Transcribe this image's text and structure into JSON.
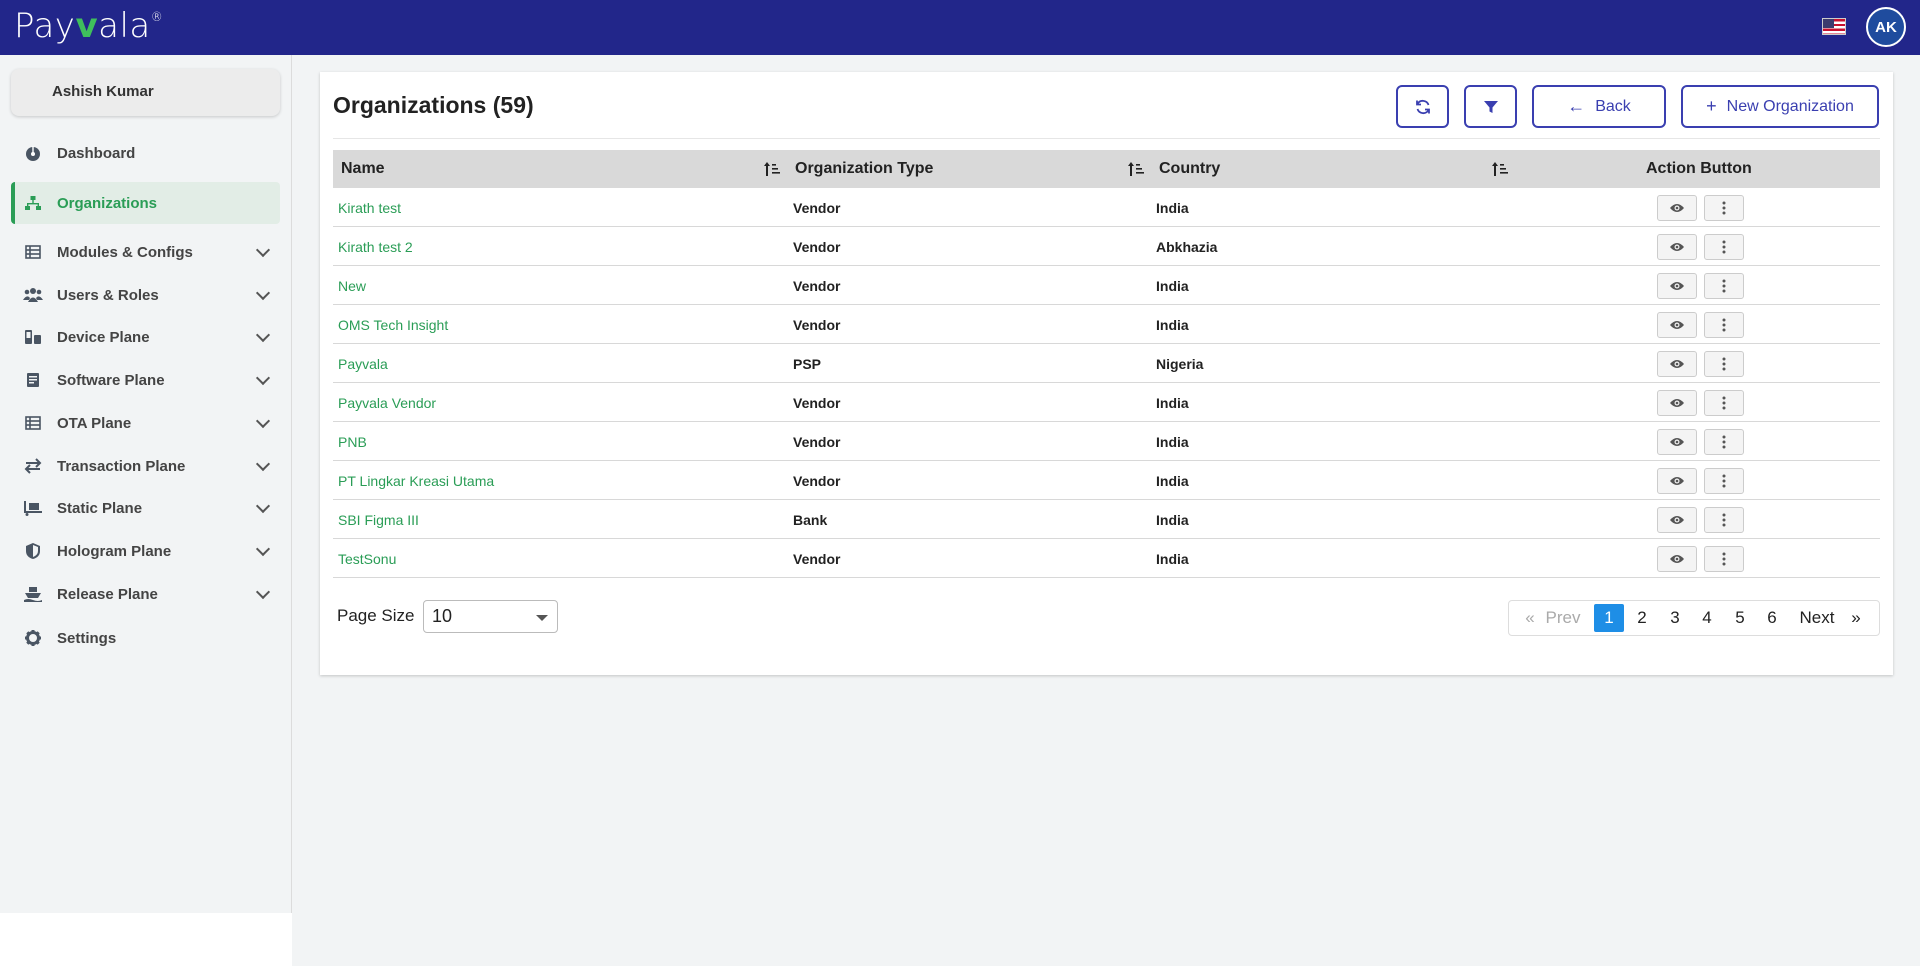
{
  "app": {
    "logo_text_left": "Pay",
    "logo_text_v": "v",
    "logo_text_right": "ala",
    "logo_mark": "®",
    "user_initials": "AK"
  },
  "sidebar": {
    "user_name": "Ashish Kumar",
    "items": [
      {
        "label": "Dashboard",
        "icon": "dashboard-icon",
        "expandable": false,
        "active": false
      },
      {
        "label": "Organizations",
        "icon": "org-tree-icon",
        "expandable": false,
        "active": true
      },
      {
        "label": "Modules & Configs",
        "icon": "table-icon",
        "expandable": true,
        "active": false
      },
      {
        "label": "Users & Roles",
        "icon": "users-icon",
        "expandable": true,
        "active": false
      },
      {
        "label": "Device Plane",
        "icon": "device-icon",
        "expandable": true,
        "active": false
      },
      {
        "label": "Software Plane",
        "icon": "software-icon",
        "expandable": true,
        "active": false
      },
      {
        "label": "OTA Plane",
        "icon": "table-icon",
        "expandable": true,
        "active": false
      },
      {
        "label": "Transaction Plane",
        "icon": "transfer-icon",
        "expandable": true,
        "active": false
      },
      {
        "label": "Static Plane",
        "icon": "dolly-icon",
        "expandable": true,
        "active": false
      },
      {
        "label": "Hologram Plane",
        "icon": "shield-icon",
        "expandable": true,
        "active": false
      },
      {
        "label": "Release Plane",
        "icon": "ship-icon",
        "expandable": true,
        "active": false
      },
      {
        "label": "Settings",
        "icon": "gear-icon",
        "expandable": false,
        "active": false
      }
    ]
  },
  "main": {
    "title": "Organizations (59)",
    "buttons": {
      "refresh_icon": "refresh-icon",
      "filter_icon": "filter-icon",
      "back_label": "Back",
      "new_label": "New Organization"
    },
    "table": {
      "columns": [
        "Name",
        "Organization Type",
        "Country",
        "Action Button"
      ],
      "rows": [
        {
          "name": "Kirath test",
          "type": "Vendor",
          "country": "India"
        },
        {
          "name": "Kirath test 2",
          "type": "Vendor",
          "country": "Abkhazia"
        },
        {
          "name": "New",
          "type": "Vendor",
          "country": "India"
        },
        {
          "name": "OMS Tech Insight",
          "type": "Vendor",
          "country": "India"
        },
        {
          "name": "Payvala",
          "type": "PSP",
          "country": "Nigeria"
        },
        {
          "name": "Payvala Vendor",
          "type": "Vendor",
          "country": "India"
        },
        {
          "name": "PNB",
          "type": "Vendor",
          "country": "India"
        },
        {
          "name": "PT Lingkar Kreasi Utama",
          "type": "Vendor",
          "country": "India"
        },
        {
          "name": "SBI Figma III",
          "type": "Bank",
          "country": "India"
        },
        {
          "name": "TestSonu",
          "type": "Vendor",
          "country": "India"
        }
      ]
    },
    "footer": {
      "page_size_label": "Page Size",
      "page_size_value": "10",
      "pager": {
        "first": "«",
        "prev": "Prev",
        "pages": [
          "1",
          "2",
          "3",
          "4",
          "5",
          "6"
        ],
        "current": "1",
        "next": "Next",
        "last": "»"
      }
    }
  },
  "colors": {
    "topbar": "#22268a",
    "accent_green": "#2a9d56",
    "button_blue": "#3a3fb0",
    "pager_active": "#1e8ee6"
  }
}
